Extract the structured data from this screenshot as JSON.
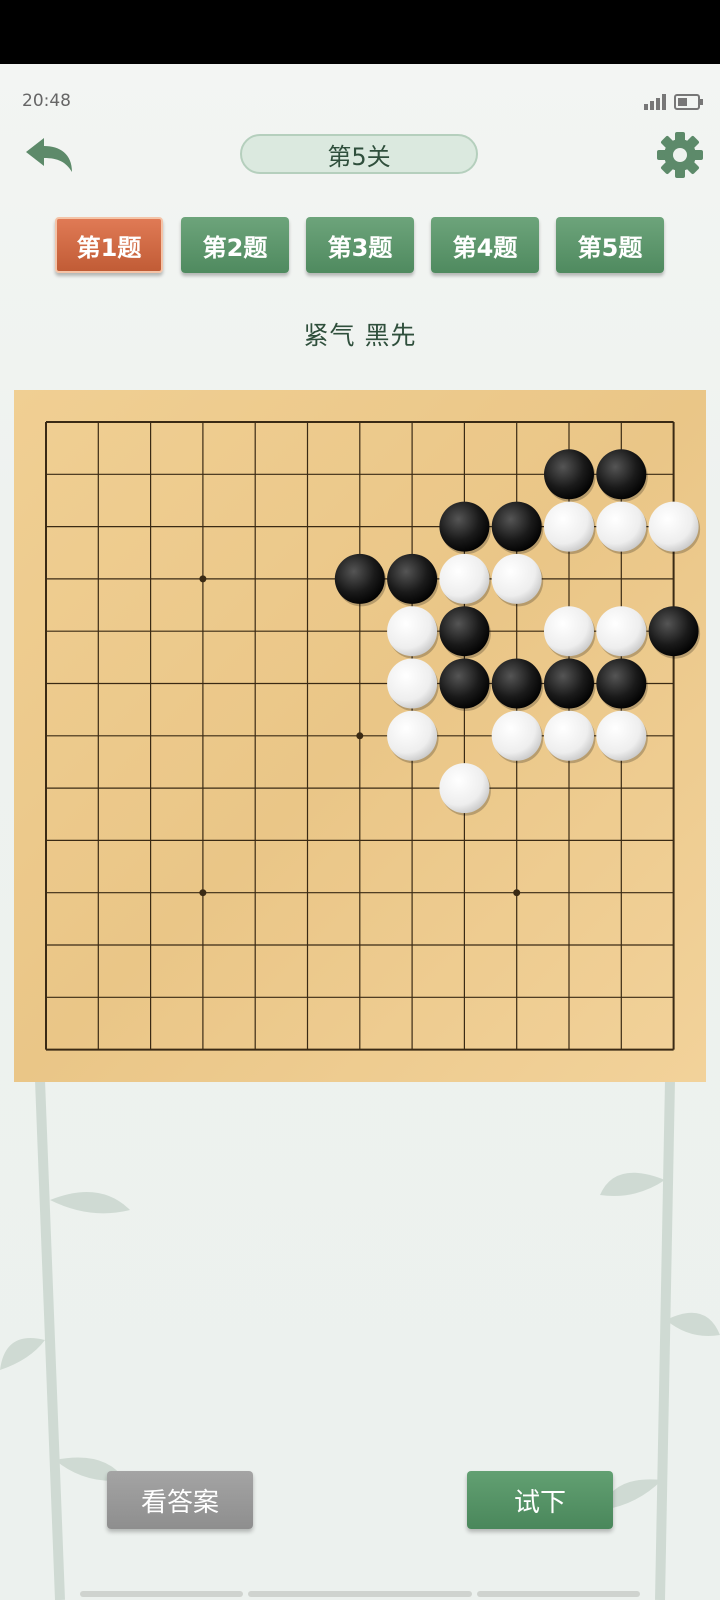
{
  "status_bar": {
    "time": "20:48"
  },
  "header": {
    "back_icon": "back-arrow-icon",
    "level_title": "第5关",
    "settings_icon": "gear-icon"
  },
  "tabs": [
    {
      "label": "第1题",
      "active": true
    },
    {
      "label": "第2题",
      "active": false
    },
    {
      "label": "第3题",
      "active": false
    },
    {
      "label": "第4题",
      "active": false
    },
    {
      "label": "第5题",
      "active": false
    }
  ],
  "puzzle": {
    "title": "紧气  黑先"
  },
  "board": {
    "size": 13,
    "star_points": [
      [
        3,
        3
      ],
      [
        6,
        6
      ],
      [
        9,
        3
      ],
      [
        3,
        9
      ],
      [
        9,
        9
      ]
    ],
    "stones": [
      {
        "color": "black",
        "col": 10,
        "row": 1
      },
      {
        "color": "black",
        "col": 11,
        "row": 1
      },
      {
        "color": "black",
        "col": 8,
        "row": 2
      },
      {
        "color": "black",
        "col": 9,
        "row": 2
      },
      {
        "color": "white",
        "col": 10,
        "row": 2
      },
      {
        "color": "white",
        "col": 11,
        "row": 2
      },
      {
        "color": "white",
        "col": 12,
        "row": 2
      },
      {
        "color": "black",
        "col": 6,
        "row": 3
      },
      {
        "color": "black",
        "col": 7,
        "row": 3
      },
      {
        "color": "white",
        "col": 8,
        "row": 3
      },
      {
        "color": "white",
        "col": 9,
        "row": 3
      },
      {
        "color": "white",
        "col": 7,
        "row": 4
      },
      {
        "color": "black",
        "col": 8,
        "row": 4
      },
      {
        "color": "white",
        "col": 10,
        "row": 4
      },
      {
        "color": "white",
        "col": 11,
        "row": 4
      },
      {
        "color": "black",
        "col": 12,
        "row": 4
      },
      {
        "color": "white",
        "col": 7,
        "row": 5
      },
      {
        "color": "black",
        "col": 8,
        "row": 5
      },
      {
        "color": "black",
        "col": 9,
        "row": 5
      },
      {
        "color": "black",
        "col": 10,
        "row": 5
      },
      {
        "color": "black",
        "col": 11,
        "row": 5
      },
      {
        "color": "white",
        "col": 7,
        "row": 6
      },
      {
        "color": "white",
        "col": 9,
        "row": 6
      },
      {
        "color": "white",
        "col": 10,
        "row": 6
      },
      {
        "color": "white",
        "col": 11,
        "row": 6
      },
      {
        "color": "white",
        "col": 8,
        "row": 7
      }
    ]
  },
  "actions": {
    "answer_label": "看答案",
    "try_label": "试下"
  }
}
